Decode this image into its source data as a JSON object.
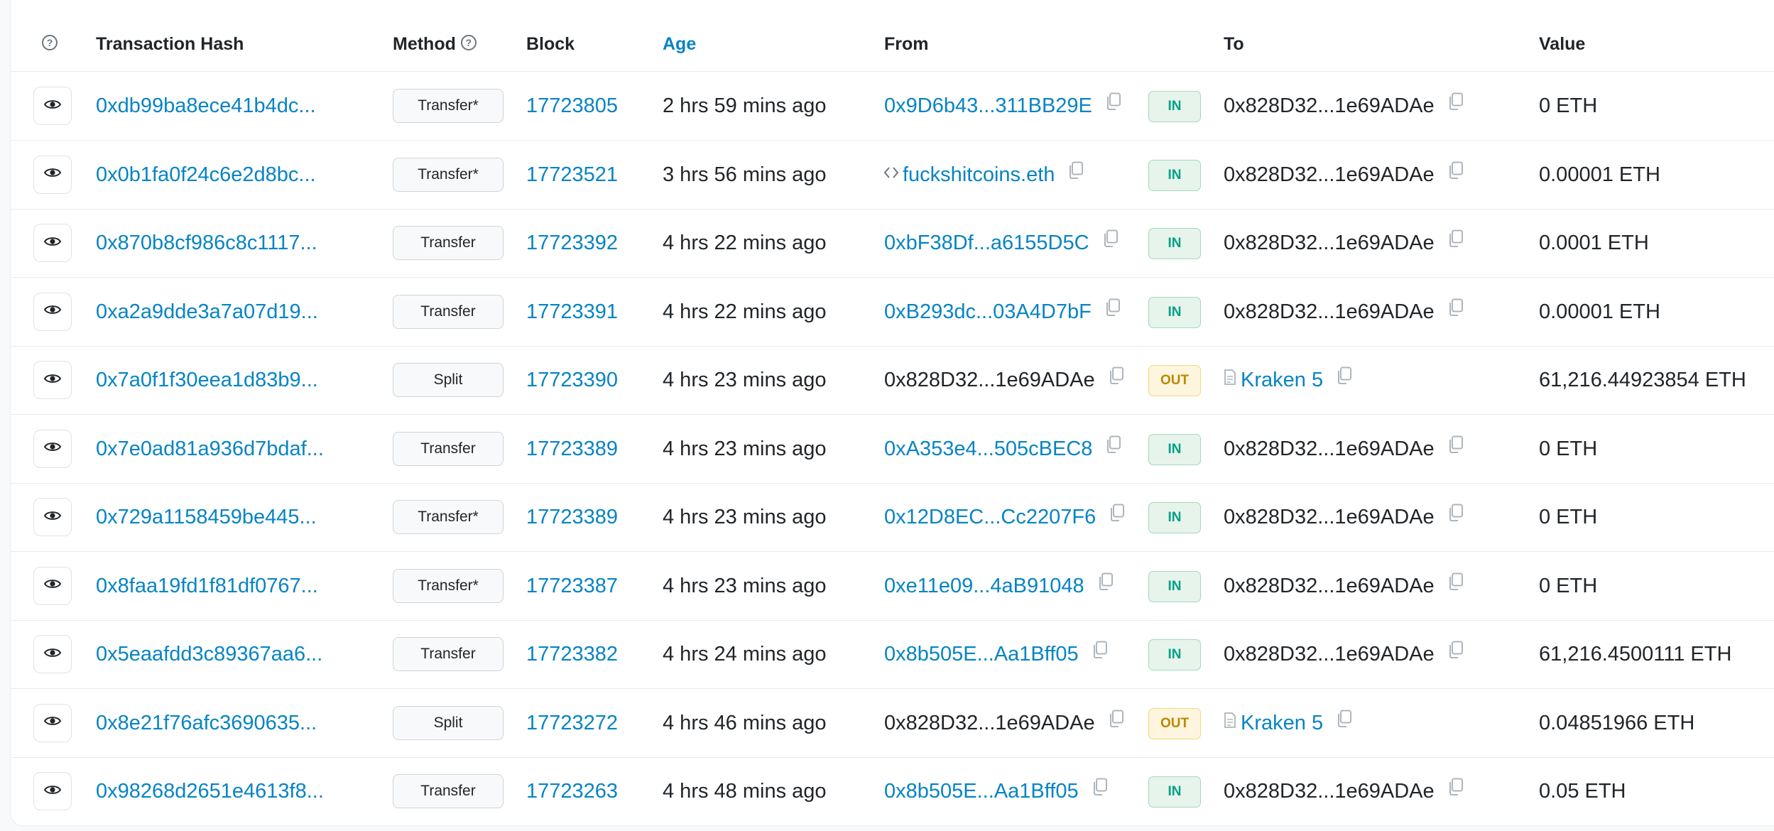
{
  "header": {
    "help_icon": "question-circle-icon",
    "hash": "Transaction Hash",
    "method": "Method",
    "block": "Block",
    "age": "Age",
    "from": "From",
    "to": "To",
    "value": "Value"
  },
  "colors": {
    "link": "#0784c3",
    "in_badge": "#00a186",
    "out_badge": "#b98900"
  },
  "rows": [
    {
      "hash": "0xdb99ba8ece41b4dc...",
      "method": "Transfer*",
      "block": "17723805",
      "age": "2 hrs 59 mins ago",
      "from": "0x9D6b43...311BB29E",
      "from_type": "link",
      "dir": "IN",
      "to": "0x828D32...1e69ADAe",
      "to_type": "plain",
      "value": "0 ETH"
    },
    {
      "hash": "0x0b1fa0f24c6e2d8bc...",
      "method": "Transfer*",
      "block": "17723521",
      "age": "3 hrs 56 mins ago",
      "from": "fuckshitcoins.eth",
      "from_type": "ens",
      "dir": "IN",
      "to": "0x828D32...1e69ADAe",
      "to_type": "plain",
      "value": "0.00001 ETH"
    },
    {
      "hash": "0x870b8cf986c8c1117...",
      "method": "Transfer",
      "block": "17723392",
      "age": "4 hrs 22 mins ago",
      "from": "0xbF38Df...a6155D5C",
      "from_type": "link",
      "dir": "IN",
      "to": "0x828D32...1e69ADAe",
      "to_type": "plain",
      "value": "0.0001 ETH"
    },
    {
      "hash": "0xa2a9dde3a7a07d19...",
      "method": "Transfer",
      "block": "17723391",
      "age": "4 hrs 22 mins ago",
      "from": "0xB293dc...03A4D7bF",
      "from_type": "link",
      "dir": "IN",
      "to": "0x828D32...1e69ADAe",
      "to_type": "plain",
      "value": "0.00001 ETH"
    },
    {
      "hash": "0x7a0f1f30eea1d83b9...",
      "method": "Split",
      "block": "17723390",
      "age": "4 hrs 23 mins ago",
      "from": "0x828D32...1e69ADAe",
      "from_type": "plain",
      "dir": "OUT",
      "to": "Kraken 5",
      "to_type": "contract",
      "value": "61,216.44923854 ETH"
    },
    {
      "hash": "0x7e0ad81a936d7bdaf...",
      "method": "Transfer",
      "block": "17723389",
      "age": "4 hrs 23 mins ago",
      "from": "0xA353e4...505cBEC8",
      "from_type": "link",
      "dir": "IN",
      "to": "0x828D32...1e69ADAe",
      "to_type": "plain",
      "value": "0 ETH"
    },
    {
      "hash": "0x729a1158459be445...",
      "method": "Transfer*",
      "block": "17723389",
      "age": "4 hrs 23 mins ago",
      "from": "0x12D8EC...Cc2207F6",
      "from_type": "link",
      "dir": "IN",
      "to": "0x828D32...1e69ADAe",
      "to_type": "plain",
      "value": "0 ETH"
    },
    {
      "hash": "0x8faa19fd1f81df0767...",
      "method": "Transfer*",
      "block": "17723387",
      "age": "4 hrs 23 mins ago",
      "from": "0xe11e09...4aB91048",
      "from_type": "link",
      "dir": "IN",
      "to": "0x828D32...1e69ADAe",
      "to_type": "plain",
      "value": "0 ETH"
    },
    {
      "hash": "0x5eaafdd3c89367aa6...",
      "method": "Transfer",
      "block": "17723382",
      "age": "4 hrs 24 mins ago",
      "from": "0x8b505E...Aa1Bff05",
      "from_type": "link",
      "dir": "IN",
      "to": "0x828D32...1e69ADAe",
      "to_type": "plain",
      "value": "61,216.4500111 ETH"
    },
    {
      "hash": "0x8e21f76afc3690635...",
      "method": "Split",
      "block": "17723272",
      "age": "4 hrs 46 mins ago",
      "from": "0x828D32...1e69ADAe",
      "from_type": "plain",
      "dir": "OUT",
      "to": "Kraken 5",
      "to_type": "contract",
      "value": "0.04851966 ETH"
    },
    {
      "hash": "0x98268d2651e4613f8...",
      "method": "Transfer",
      "block": "17723263",
      "age": "4 hrs 48 mins ago",
      "from": "0x8b505E...Aa1Bff05",
      "from_type": "link",
      "dir": "IN",
      "to": "0x828D32...1e69ADAe",
      "to_type": "plain",
      "value": "0.05 ETH"
    }
  ]
}
